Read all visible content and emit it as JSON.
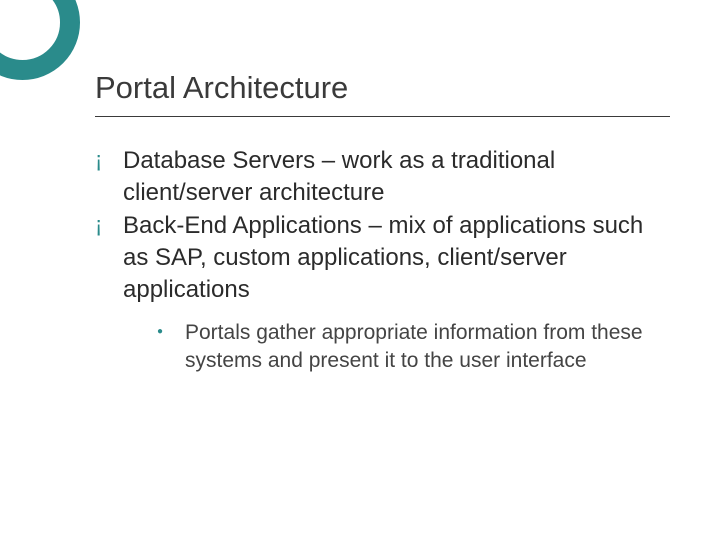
{
  "slide": {
    "title": "Portal Architecture",
    "bullets": [
      {
        "text": "Database Servers – work as a traditional client/server architecture"
      },
      {
        "text": "Back-End Applications – mix of applications such as SAP, custom applications, client/server applications",
        "sub": [
          {
            "text": "Portals gather appropriate information from these systems and present it to the user interface"
          }
        ]
      }
    ]
  }
}
